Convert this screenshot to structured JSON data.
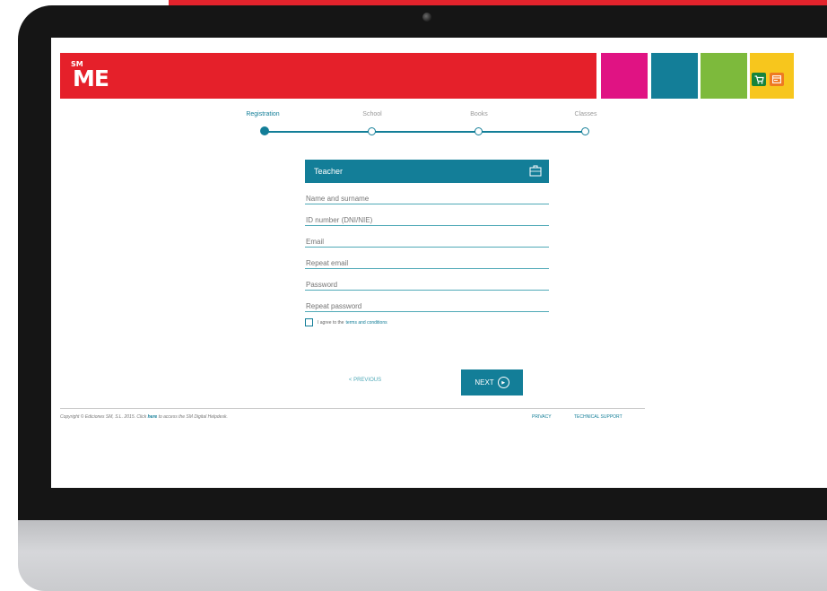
{
  "brand": {
    "logo": "ME",
    "logo_small": "SM"
  },
  "colors": {
    "brand_red": "#e5202a",
    "accent_teal": "#137e98",
    "tile_pink": "#e01383",
    "tile_green": "#7dba3c",
    "tile_yellow": "#f7c61d"
  },
  "header_icons": [
    "cart-icon",
    "card-icon"
  ],
  "steps": [
    {
      "label": "Registration",
      "active": true
    },
    {
      "label": "School",
      "active": false
    },
    {
      "label": "Books",
      "active": false
    },
    {
      "label": "Classes",
      "active": false
    }
  ],
  "form": {
    "title": "Teacher",
    "title_icon": "briefcase-icon",
    "fields": [
      {
        "placeholder": "Name and surname"
      },
      {
        "placeholder": "ID number (DNI/NIE)"
      },
      {
        "placeholder": "Email"
      },
      {
        "placeholder": "Repeat email"
      },
      {
        "placeholder": "Password"
      },
      {
        "placeholder": "Repeat password"
      }
    ],
    "terms_text": "I agree to the",
    "terms_link": "terms and conditions",
    "terms_checked": false
  },
  "nav": {
    "previous": "< PREVIOUS",
    "next": "NEXT"
  },
  "footer": {
    "copyright_pre": "Copyright © Ediciones SM, S.L. 2015. Click",
    "copyright_here": "here",
    "copyright_post": "to access the SM Digital Helpdesk.",
    "privacy": "PRIVACY",
    "support": "TECHNICAL SUPPORT"
  }
}
